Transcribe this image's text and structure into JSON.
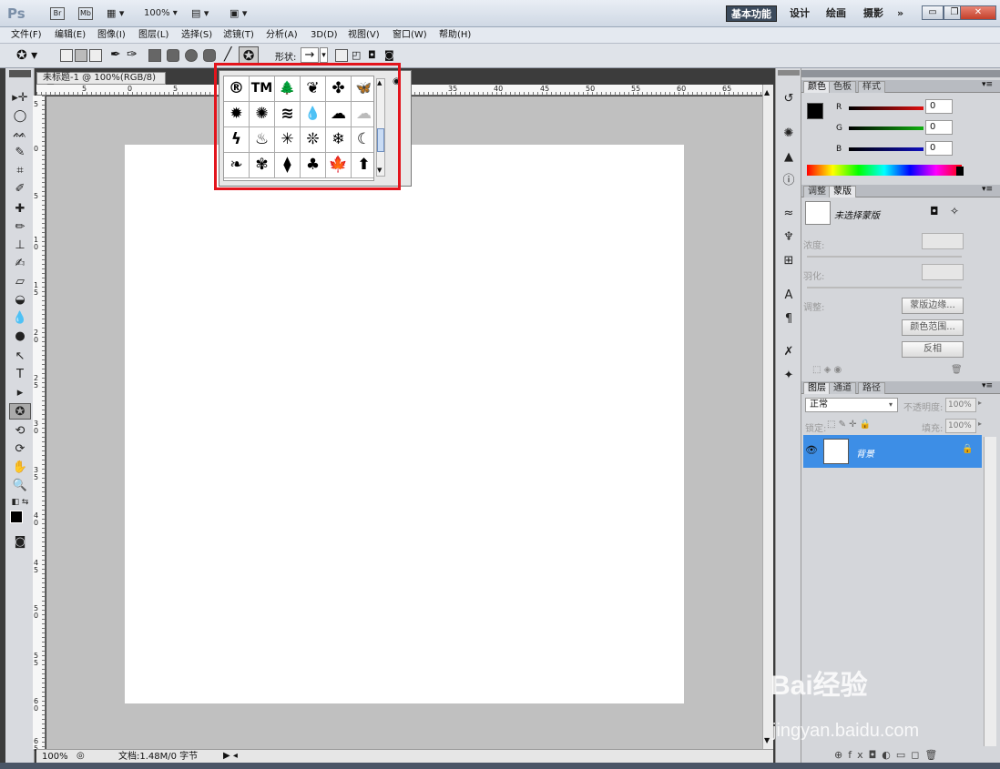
{
  "app": {
    "logo": "Ps",
    "bridge_btn": "Br",
    "minibridge_btn": "Mb",
    "zoom_select": "100%",
    "workspaces": [
      "基本功能",
      "设计",
      "绘画",
      "摄影",
      "»"
    ]
  },
  "menu": [
    "文件(F)",
    "编辑(E)",
    "图像(I)",
    "图层(L)",
    "选择(S)",
    "滤镜(T)",
    "分析(A)",
    "3D(D)",
    "视图(V)",
    "窗口(W)",
    "帮助(H)"
  ],
  "options": {
    "shape_label": "形状:",
    "shape_arrow": "→"
  },
  "document": {
    "tab_title": "未标题-1 @ 100%(RGB/8)",
    "tab_close": "☒",
    "status_zoom": "100%",
    "status_doc": "文档:1.48M/0 字节",
    "ruler_h_labels": [
      "5",
      "0",
      "5",
      "35",
      "40",
      "45",
      "50",
      "55",
      "60",
      "65"
    ],
    "ruler_v_labels": [
      "5",
      "0",
      "5",
      "1 0",
      "1 5",
      "2 0",
      "2 5",
      "3 0",
      "3 5",
      "4 0",
      "4 5",
      "5 0",
      "5 5",
      "6 0",
      "6 5"
    ]
  },
  "shape_picker": {
    "shapes": [
      "®",
      "TM",
      "🌲",
      "❦",
      "✤",
      "🦋",
      "✹",
      "✺",
      "≋",
      "💧",
      "☁",
      "☁",
      "ϟ",
      "♨",
      "✳",
      "❊",
      "❄",
      "☾",
      "❧",
      "✾",
      "⧫",
      "♣",
      "🍁",
      "⬆"
    ]
  },
  "color_panel": {
    "tabs": [
      "颜色",
      "色板",
      "样式"
    ],
    "channels": [
      {
        "label": "R",
        "value": "0",
        "color": "#e01010"
      },
      {
        "label": "G",
        "value": "0",
        "color": "#10b010"
      },
      {
        "label": "B",
        "value": "0",
        "color": "#1010c0"
      }
    ]
  },
  "mask_panel": {
    "tabs": [
      "调整",
      "蒙版"
    ],
    "no_mask": "未选择蒙版",
    "density": "浓度:",
    "feather": "羽化:",
    "refine": "调整:",
    "btn_edge": "蒙版边缘...",
    "btn_range": "颜色范围...",
    "btn_invert": "反相"
  },
  "layers_panel": {
    "tabs": [
      "图层",
      "通道",
      "路径"
    ],
    "blend_mode": "正常",
    "opacity_label": "不透明度:",
    "opacity": "100%",
    "lock_label": "锁定:",
    "fill_label": "填充:",
    "fill": "100%",
    "layer_name": "背景"
  },
  "watermark": {
    "line1": "Bai经验",
    "line2": "jingyan.baidu.com"
  }
}
